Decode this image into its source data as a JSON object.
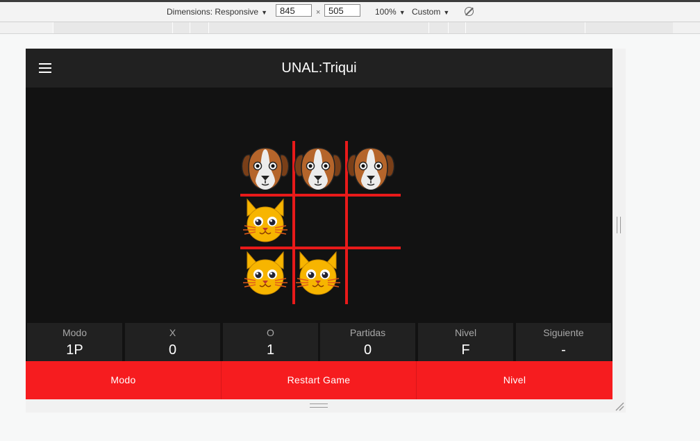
{
  "devtools": {
    "dimensions_label": "Dimensions: Responsive",
    "width_value": "845",
    "times_symbol": "×",
    "height_value": "505",
    "zoom_label": "100%",
    "throttle_label": "Custom",
    "rotate_icon": "rotate-icon"
  },
  "app": {
    "title": "UNAL:Triqui",
    "menu_icon": "hamburger-menu-icon",
    "board": [
      [
        "dog",
        "dog",
        "dog"
      ],
      [
        "cat",
        "",
        ""
      ],
      [
        "cat",
        "cat",
        ""
      ]
    ],
    "line_color": "#e81a1a",
    "stats": [
      {
        "label": "Modo",
        "value": "1P"
      },
      {
        "label": "X",
        "value": "0"
      },
      {
        "label": "O",
        "value": "1"
      },
      {
        "label": "Partidas",
        "value": "0"
      },
      {
        "label": "Nivel",
        "value": "F"
      },
      {
        "label": "Siguiente",
        "value": "-"
      }
    ],
    "actions": [
      {
        "label": "Modo"
      },
      {
        "label": "Restart Game"
      },
      {
        "label": "Nivel"
      }
    ],
    "accent_color": "#f61c1f"
  }
}
